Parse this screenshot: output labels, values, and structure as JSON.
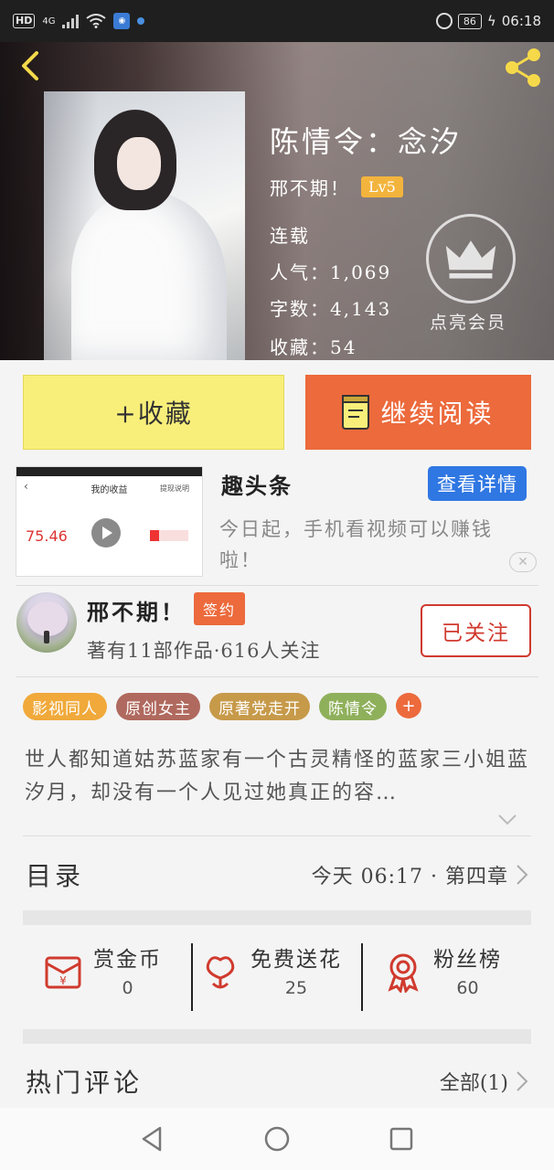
{
  "status_bar": {
    "hd": "HD",
    "network": "4G",
    "battery": "86",
    "time": "06:18"
  },
  "header": {
    "book_title": "陈情令：念汐",
    "author": "邢不期！",
    "level": "Lv5",
    "status": "连载",
    "popularity": "人气：1,069",
    "word_count": "字数：4,143",
    "favorites": "收藏：54",
    "vip_label": "点亮会员"
  },
  "actions": {
    "collect": "+收藏",
    "continue_reading": "继续阅读"
  },
  "ad": {
    "thumb_title": "我的收益",
    "thumb_link": "提现说明",
    "thumb_amount": "75.46",
    "brand": "趣头条",
    "detail_button": "查看详情",
    "description": "今日起，手机看视频可以赚钱啦！",
    "close": "✕"
  },
  "author_section": {
    "name": "邢不期！",
    "signed_badge": "签约",
    "stats": "著有11部作品·616人关注",
    "follow_button": "已关注"
  },
  "tags": [
    {
      "label": "影视同人",
      "color": "#f0a93a"
    },
    {
      "label": "原创女主",
      "color": "#b0695e"
    },
    {
      "label": "原著党走开",
      "color": "#c79a4a"
    },
    {
      "label": "陈情令",
      "color": "#8fb05b"
    }
  ],
  "tag_add": "+",
  "synopsis": "世人都知道姑苏蓝家有一个古灵精怪的蓝家三小姐蓝汐月，却没有一个人见过她真正的容…",
  "catalog": {
    "title": "目录",
    "latest": "今天 06:17 · 第四章"
  },
  "stats": {
    "coins": {
      "label": "赏金币",
      "value": "0"
    },
    "flowers": {
      "label": "免费送花",
      "value": "25"
    },
    "fans": {
      "label": "粉丝榜",
      "value": "60"
    }
  },
  "comments": {
    "title": "热门评论",
    "all": "全部(1)"
  },
  "colors": {
    "accent_orange": "#ec6a3c",
    "collect_yellow": "#f8ef7a",
    "follow_red": "#d03a2e",
    "detail_blue": "#2f77e2",
    "level_gold": "#f3b43d"
  }
}
